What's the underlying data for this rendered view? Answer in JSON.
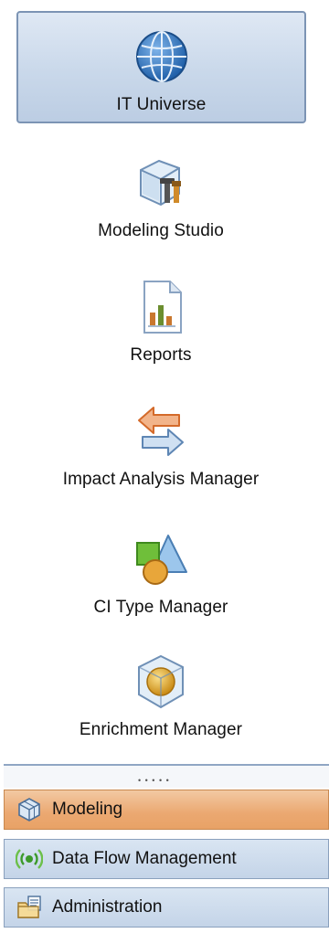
{
  "modules": [
    {
      "label": "IT Universe",
      "icon": "globe-icon",
      "selected": true
    },
    {
      "label": "Modeling Studio",
      "icon": "modeling-cube-tools-icon"
    },
    {
      "label": "Reports",
      "icon": "report-document-icon"
    },
    {
      "label": "Impact Analysis Manager",
      "icon": "swap-arrows-icon"
    },
    {
      "label": "CI Type Manager",
      "icon": "shapes-icon"
    },
    {
      "label": "Enrichment Manager",
      "icon": "enrichment-sphere-icon"
    }
  ],
  "bottom_bars": [
    {
      "label": "Modeling",
      "icon": "modeling-cube-icon",
      "active": true
    },
    {
      "label": "Data Flow Management",
      "icon": "signal-icon"
    },
    {
      "label": "Administration",
      "icon": "admin-folder-icon"
    }
  ],
  "colors": {
    "selected_module_bg": "#c9d8ea",
    "active_bar": "#eba871",
    "inactive_bar": "#c4d4e8"
  }
}
